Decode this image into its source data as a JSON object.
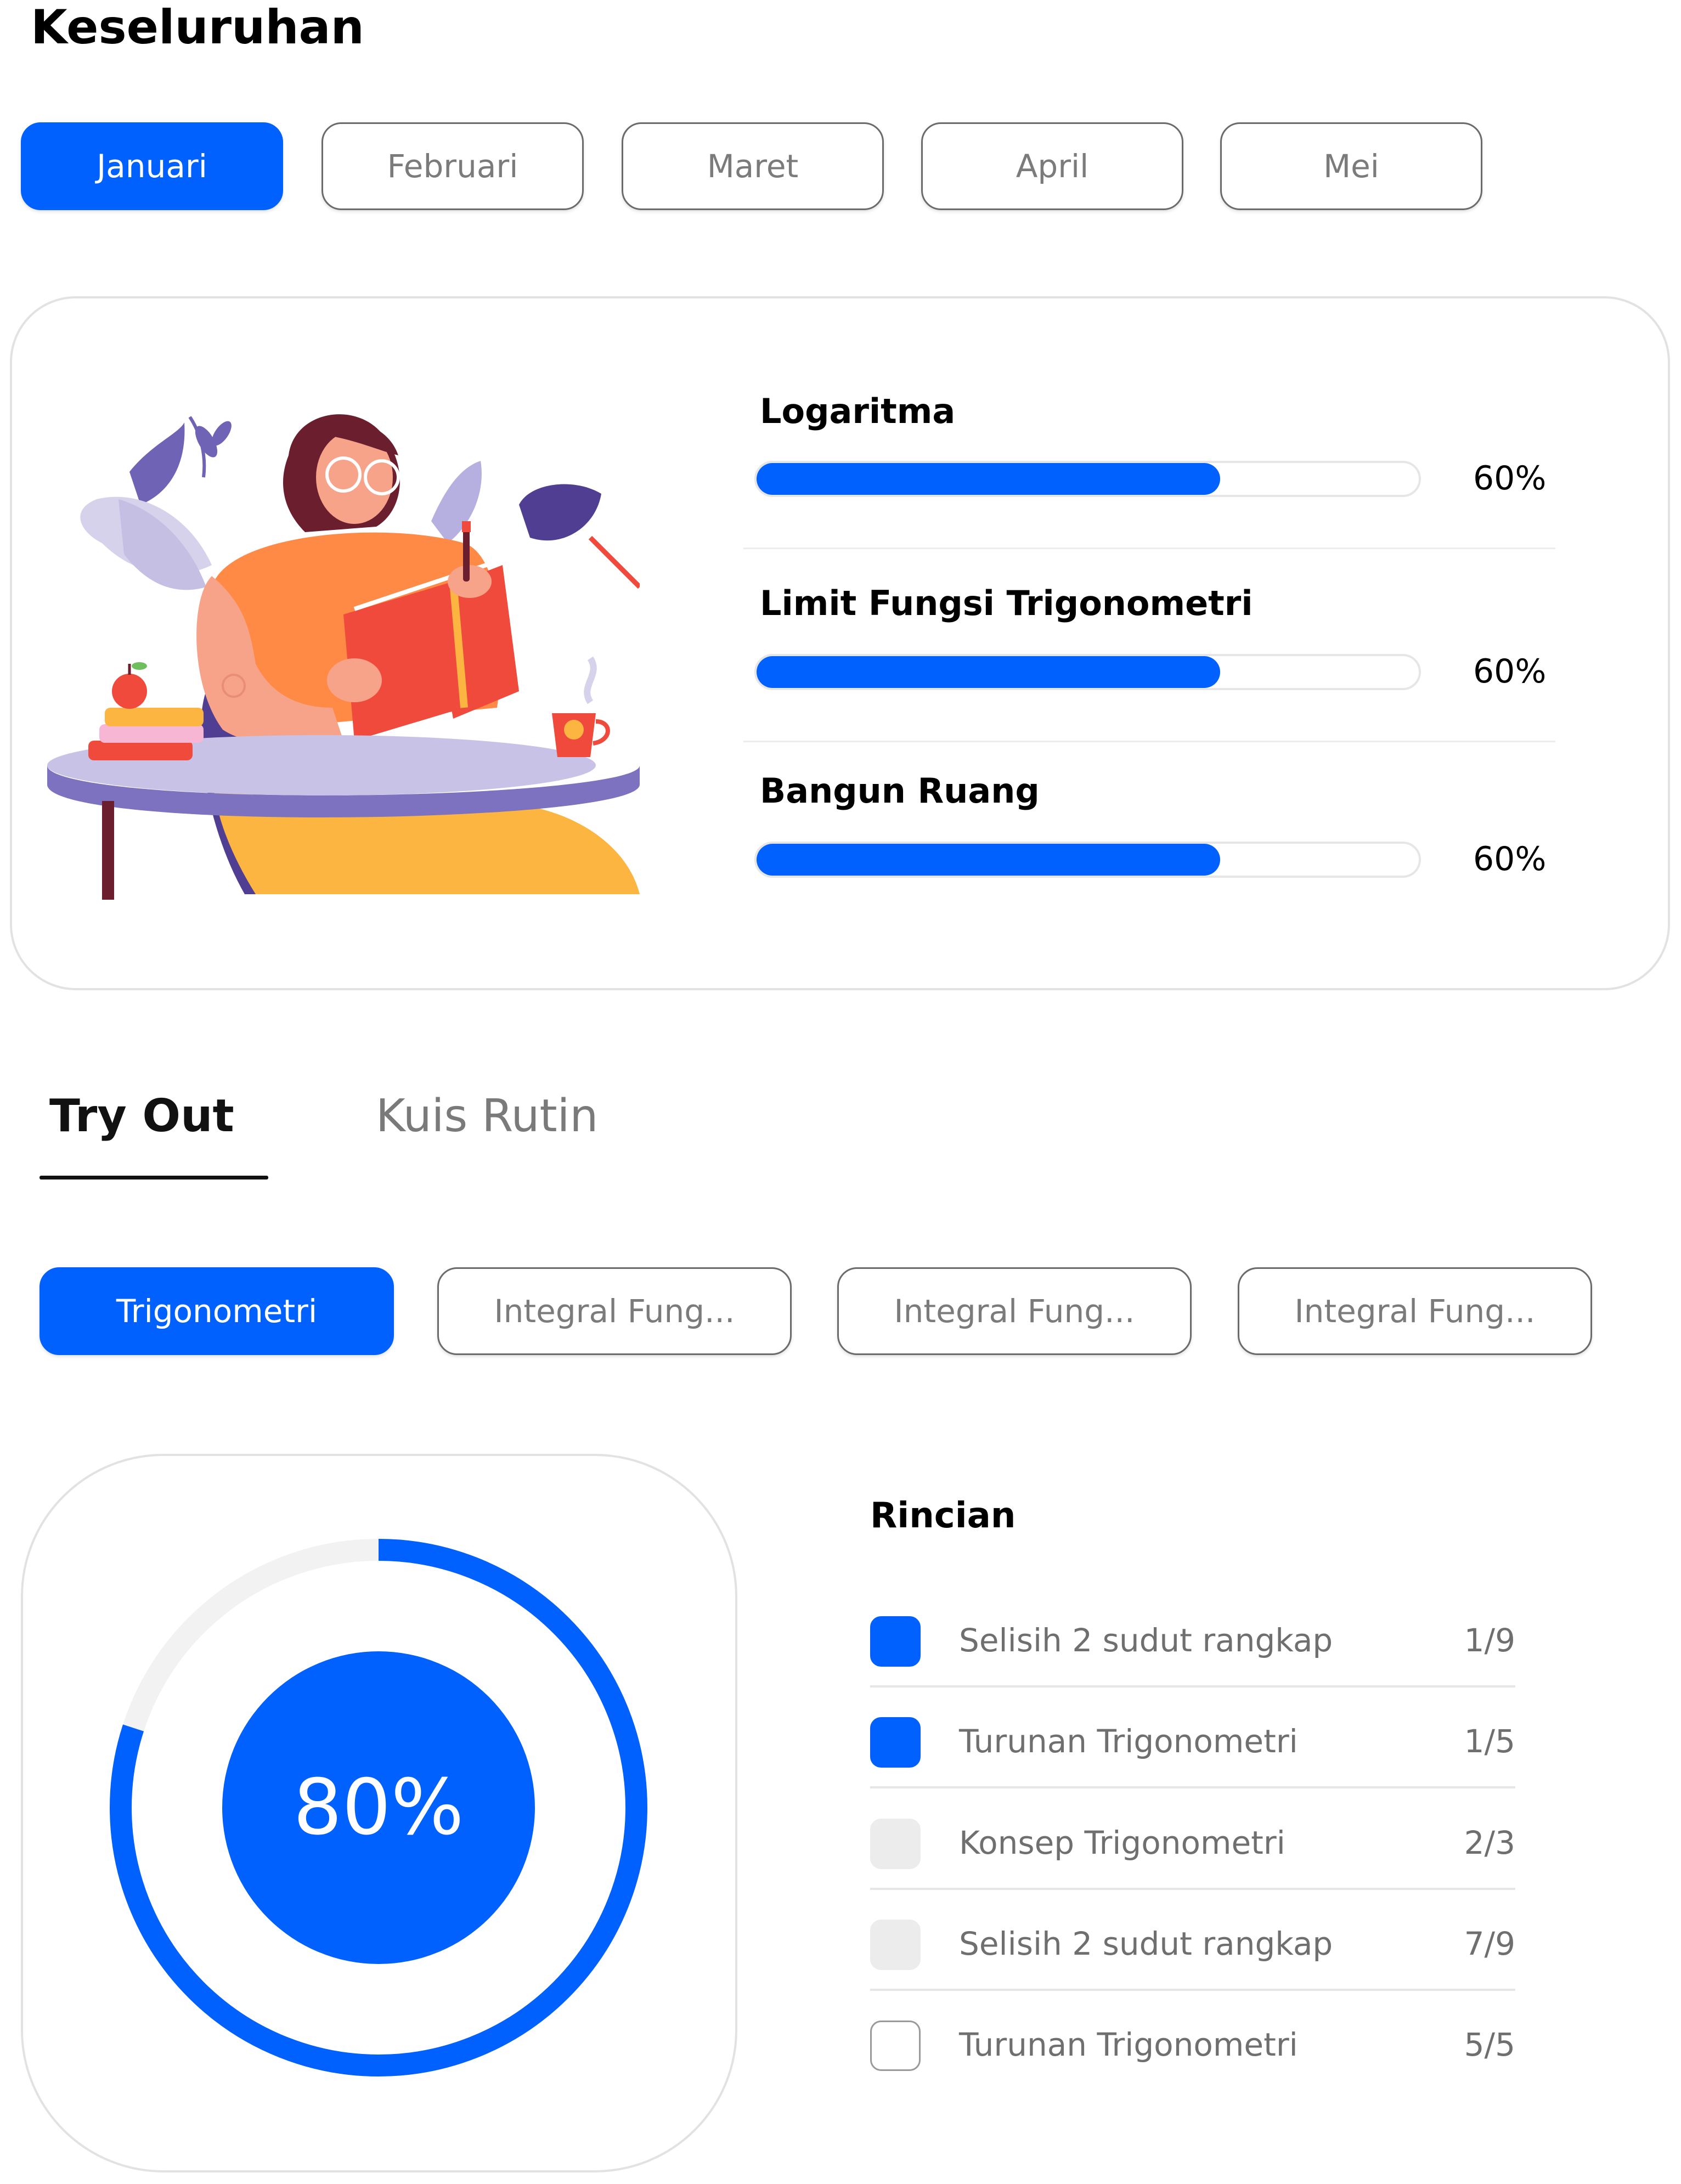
{
  "page": {
    "title": "Keseluruhan"
  },
  "months": {
    "items": [
      "Januari",
      "Februari",
      "Maret",
      "April",
      "Mei"
    ],
    "active_index": 0
  },
  "summary": {
    "topics": [
      {
        "name": "Logaritma",
        "percent_label": "60%",
        "progress": 0.7
      },
      {
        "name": "Limit Fungsi Trigonometri",
        "percent_label": "60%",
        "progress": 0.7
      },
      {
        "name": "Bangun Ruang",
        "percent_label": "60%",
        "progress": 0.7
      }
    ],
    "illustration_icon": "woman-reading-book-illustration"
  },
  "tabs": {
    "items": [
      "Try Out",
      "Kuis Rutin"
    ],
    "active_index": 0
  },
  "subjects": {
    "items": [
      "Trigonometri",
      "Integral Fung...",
      "Integral Fung...",
      "Integral Fung..."
    ],
    "active_index": 0
  },
  "score": {
    "value_label": "80%",
    "progress": 0.8
  },
  "details": {
    "title": "Rincian",
    "items": [
      {
        "label": "Selisih 2 sudut rangkap",
        "score": "1/9",
        "marker": "filled"
      },
      {
        "label": "Turunan Trigonometri",
        "score": "1/5",
        "marker": "filled"
      },
      {
        "label": "Konsep Trigonometri",
        "score": "2/3",
        "marker": "light"
      },
      {
        "label": "Selisih 2 sudut rangkap",
        "score": "7/9",
        "marker": "light"
      },
      {
        "label": "Turunan Trigonometri",
        "score": "5/5",
        "marker": "empty"
      }
    ]
  },
  "colors": {
    "accent": "#0061fe",
    "track": "#f2f2f2",
    "muted_text": "#7b7b7b"
  }
}
